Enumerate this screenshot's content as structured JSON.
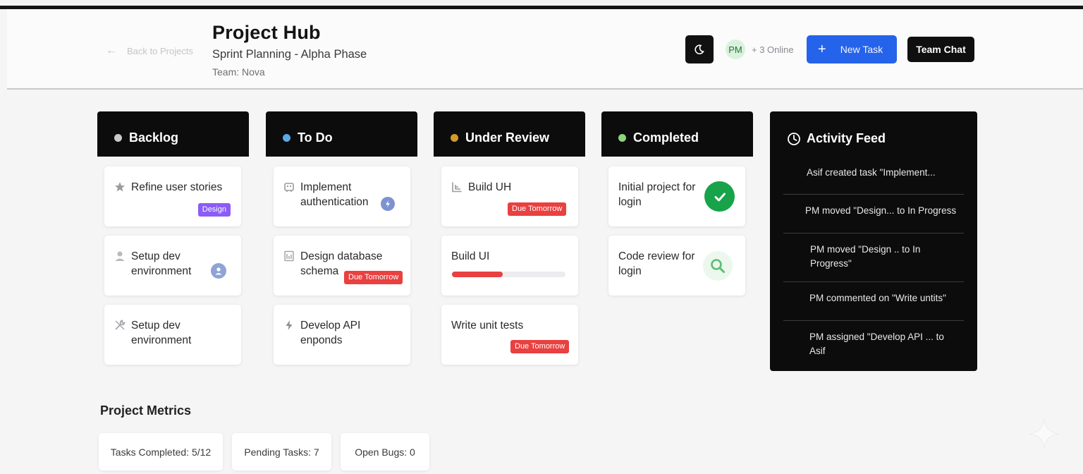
{
  "header": {
    "back_label": "Back to Projects",
    "title": "Project Hub",
    "subtitle": "Sprint Planning - Alpha Phase",
    "team": "Team: Nova",
    "avatar_initials": "PM",
    "online_label": "+ 3 Online",
    "new_task_label": "New Task",
    "team_chat_label": "Team Chat"
  },
  "columns": [
    {
      "title": "Backlog",
      "dot_color": "#c9c9c9"
    },
    {
      "title": "To Do",
      "dot_color": "#5aa9e6"
    },
    {
      "title": "Under Review",
      "dot_color": "#d39a2a"
    },
    {
      "title": "Completed",
      "dot_color": "#8dd47a"
    }
  ],
  "cards": {
    "backlog": [
      {
        "text": "Refine user stories",
        "icon": "star-icon",
        "tag": "Design"
      },
      {
        "text": "Setup dev environment",
        "icon": "user-icon",
        "badge": "user-avatar-icon"
      },
      {
        "text": "Setup dev environment",
        "icon": "tools-icon"
      }
    ],
    "todo": [
      {
        "text": "Implement authentication",
        "icon": "robot-icon",
        "badge": "lightning-badge-icon"
      },
      {
        "text": "Design database schema",
        "icon": "database-icon",
        "tag": "Due Tomorrow"
      },
      {
        "text": "Develop API enponds",
        "icon": "lightning-icon"
      }
    ],
    "review": [
      {
        "text": "Build UH",
        "icon": "layout-icon",
        "tag": "Due Tomorrow"
      },
      {
        "text": "Build UI",
        "progress": 0.45
      },
      {
        "text": "Write unit tests",
        "tag": "Due Tomorrow"
      }
    ],
    "completed": [
      {
        "text": "Initial project for login",
        "badge": "checkmark-icon"
      },
      {
        "text": "Code review for login",
        "badge": "magnifier-icon"
      }
    ]
  },
  "feed": {
    "title": "Activity Feed",
    "items": [
      "Asif created task \"Implement...",
      "PM moved \"Design... to In Progress",
      "PM moved \"Design ..   to In Progress\"",
      "PM commented on \"Write untits\"",
      "PM assigned \"Develop API ... to Asif"
    ]
  },
  "metrics": {
    "title": "Project Metrics",
    "items": [
      "Tasks Completed: 5/12",
      "Pending Tasks: 7",
      "Open Bugs: 0"
    ]
  },
  "colors": {
    "accent": "#2563eb",
    "dark": "#0c0c0c",
    "due": "#e94040",
    "design_tag": "#8b5cf6",
    "success": "#16a34a"
  }
}
